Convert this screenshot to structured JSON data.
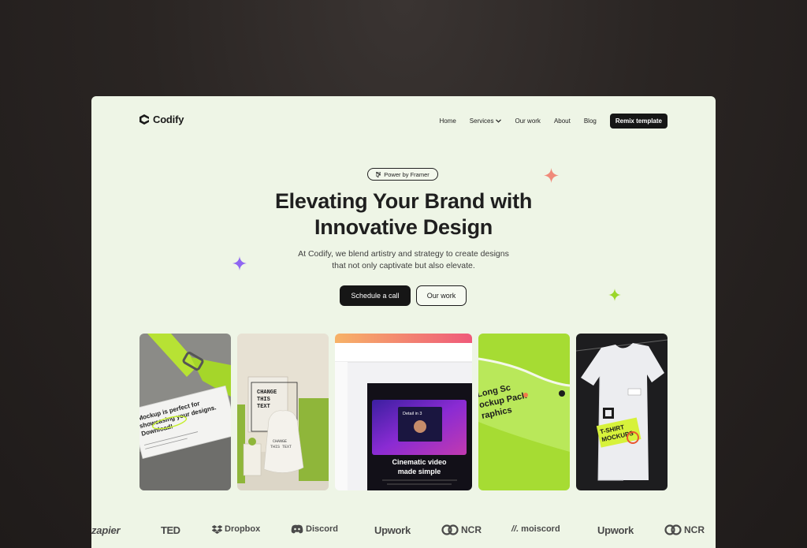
{
  "brand": {
    "name": "Codify"
  },
  "nav": {
    "items": [
      {
        "label": "Home"
      },
      {
        "label": "Services"
      },
      {
        "label": "Our work"
      },
      {
        "label": "About"
      },
      {
        "label": "Blog"
      }
    ],
    "cta": "Remix template"
  },
  "hero": {
    "badge": "Power by Framer",
    "title_line1": "Elevating Your Brand with",
    "title_line2": "Innovative Design",
    "sub_line1": "At Codify, we blend artistry and strategy to create designs",
    "sub_line2": "that not only captivate but also elevate.",
    "primary_cta": "Schedule a call",
    "secondary_cta": "Our work"
  },
  "gallery": {
    "card1": {
      "text_line1": "Mockup is perfect for",
      "text_line2": "showcasing your designs.",
      "text_line3": "Download!"
    },
    "card2": {
      "sign_line1": "CHANGE",
      "sign_line2": "THIS",
      "sign_line3": "TEXT",
      "bag_line1": "CHANGE",
      "bag_line2": "THIS TEXT"
    },
    "card3": {
      "headline_line1": "Cinematic video",
      "headline_line2": "made simple",
      "inner_title": "Detail in 3"
    },
    "card4": {
      "text_line1": "Long Sc",
      "text_line2": "ockup Pack",
      "text_line3": "raphics"
    },
    "card5": {
      "text_line1": "T-SHIRT",
      "text_line2": "MOCKUPS"
    }
  },
  "logos": [
    {
      "name": "zapier",
      "label": "zapier"
    },
    {
      "name": "ted",
      "label": "TED"
    },
    {
      "name": "dropbox",
      "label": "Dropbox"
    },
    {
      "name": "discord",
      "label": "Discord"
    },
    {
      "name": "upwork",
      "label": "Upwork"
    },
    {
      "name": "ncr",
      "label": "NCR"
    },
    {
      "name": "moiscord",
      "label": "moiscord"
    },
    {
      "name": "upwork2",
      "label": "Upwork"
    },
    {
      "name": "ncr2",
      "label": "NCR"
    }
  ],
  "colors": {
    "accent_green": "#a9dc2f",
    "page_bg": "#eef5e6",
    "dark": "#161616",
    "sparkle_coral": "#f08a7a",
    "sparkle_purple": "#8f66f2",
    "sparkle_green": "#9bd72a"
  }
}
